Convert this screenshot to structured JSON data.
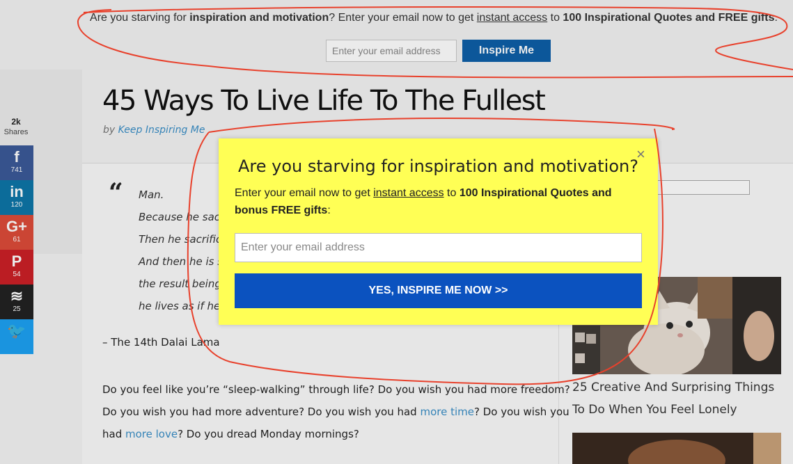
{
  "topbar": {
    "text_pre": "Are you starving for ",
    "text_bold1": "inspiration and motivation",
    "text_mid1": "? Enter your email now to get ",
    "text_link": "instant access",
    "text_mid2": " to ",
    "text_bold2": "100 Inspirational Quotes and FREE gifts",
    "text_post": ".",
    "email_placeholder": "Enter your email address",
    "button_label": "Inspire Me"
  },
  "article": {
    "title": "45 Ways To Live Life To The Fullest",
    "byline_prefix": "by ",
    "byline_author": "Keep Inspiring Me",
    "quote_mark": "“",
    "quote_lines": [
      "Man.",
      "Because he sacrifi",
      "Then he sacrifices",
      "And then he is so a",
      "the result being th",
      "he lives as if he is n"
    ],
    "attribution": "– The 14th Dalai Lama",
    "para1": "Do you feel like you’re “sleep-walking” through life? Do you wish you had more freedom?",
    "para2_pre": "Do you wish you had more adventure? Do you wish you had ",
    "para2_link": "more time",
    "para2_post": "? Do you wish you",
    "para3_pre": "had ",
    "para3_link": "more love",
    "para3_post": "? Do you dread Monday mornings?"
  },
  "share": {
    "count": "2k",
    "label": "Shares",
    "buttons": [
      {
        "network": "facebook",
        "glyph": "f",
        "count": "741",
        "color": "#3b5998"
      },
      {
        "network": "linkedin",
        "glyph": "in",
        "count": "120",
        "color": "#0e76a8"
      },
      {
        "network": "google-plus",
        "glyph": "G+",
        "count": "61",
        "color": "#dd4b39"
      },
      {
        "network": "pinterest",
        "glyph": "P",
        "count": "54",
        "color": "#cb2027"
      },
      {
        "network": "buffer",
        "glyph": "≋",
        "count": "25",
        "color": "#222222"
      },
      {
        "network": "twitter",
        "glyph": "🐦",
        "count": "",
        "color": "#1da1f2"
      }
    ]
  },
  "sidebar": {
    "caption": "25 Creative And Surprising Things To Do When You Feel Lonely"
  },
  "modal": {
    "close": "×",
    "title": "Are you starving for inspiration and motivation?",
    "sub_pre": "Enter your email now to get ",
    "sub_link": "instant access",
    "sub_mid": " to ",
    "sub_bold": "100 Inspirational Quotes and bonus FREE gifts",
    "sub_post": ":",
    "email_placeholder": "Enter your email address",
    "button_label": "YES, INSPIRE ME NOW >>"
  },
  "colors": {
    "modal_bg": "#ffff55",
    "modal_button": "#0b52bf",
    "topbar_button": "#0e5fa8",
    "link": "#3a8fc7",
    "annotation": "#e8412c"
  }
}
